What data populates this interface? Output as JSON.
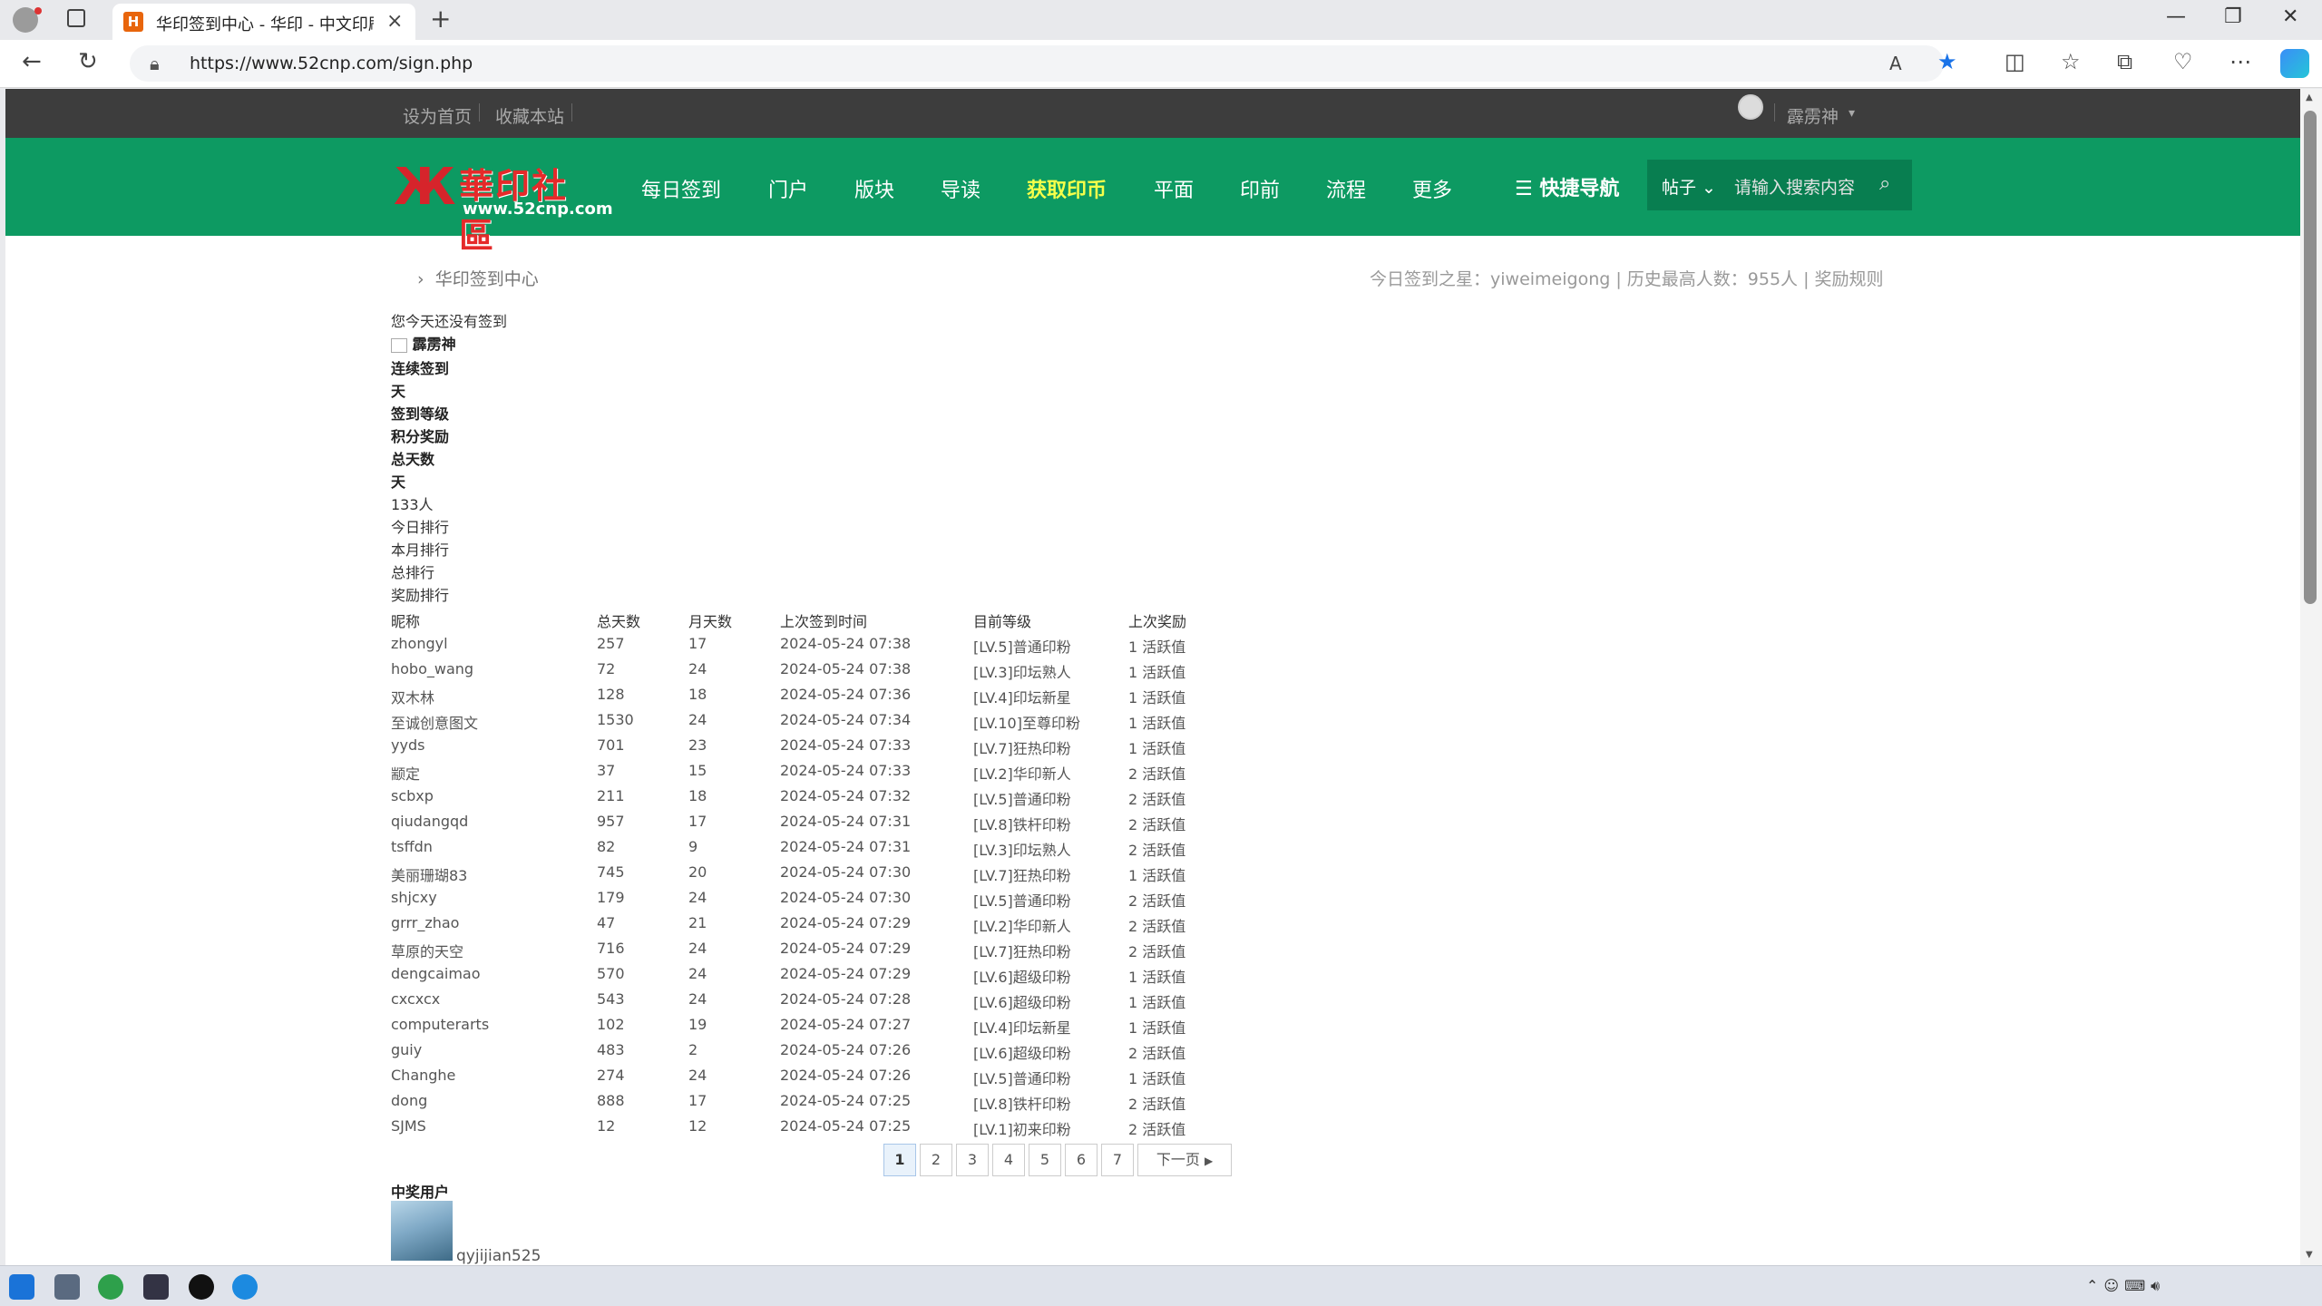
{
  "browser": {
    "tab_title": "华印签到中心 - 华印 - 中文印刷",
    "url": "https://www.52cnp.com/sign.php",
    "favicon_icon": "52cnp-logo-icon"
  },
  "site": {
    "top_links": [
      "设为首页",
      "收藏本站"
    ],
    "username": "霹雳神",
    "logo_cn": "華印社區",
    "logo_en": "www.52cnp.com",
    "nav": [
      "每日签到",
      "门户",
      "版块",
      "导读",
      "获取印币",
      "平面",
      "印前",
      "流程",
      "更多"
    ],
    "nav_highlight": "获取印币",
    "quick_nav": "☰ 快捷导航",
    "search_select": "帖子",
    "search_placeholder": "请输入搜索内容"
  },
  "breadcrumb": "华印签到中心",
  "stats": {
    "text": "今日签到之星：yiweimeigong  |  历史最高人数：955人  |  奖励规则"
  },
  "status": {
    "not_signed": "您今天还没有签到",
    "user_label": "霹雳神",
    "continuous": "连续签到",
    "day1": "天",
    "level": "签到等级",
    "points": "积分奖励",
    "total_days": "总天数",
    "day2": "天",
    "count": "133人",
    "today_rank": "今日排行",
    "month_rank": "本月排行",
    "total_rank": "总排行",
    "reward_rank": "奖励排行"
  },
  "table": {
    "headers": [
      "昵称",
      "总天数",
      "月天数",
      "上次签到时间",
      "目前等级",
      "上次奖励"
    ],
    "rows": [
      [
        "zhongyl",
        "257",
        "17",
        "2024-05-24 07:38",
        "[LV.5]普通印粉",
        "1 活跃值"
      ],
      [
        "hobo_wang",
        "72",
        "24",
        "2024-05-24 07:38",
        "[LV.3]印坛熟人",
        "1 活跃值"
      ],
      [
        "双木林",
        "128",
        "18",
        "2024-05-24 07:36",
        "[LV.4]印坛新星",
        "1 活跃值"
      ],
      [
        "至诚创意图文",
        "1530",
        "24",
        "2024-05-24 07:34",
        "[LV.10]至尊印粉",
        "1 活跃值"
      ],
      [
        "yyds",
        "701",
        "23",
        "2024-05-24 07:33",
        "[LV.7]狂热印粉",
        "1 活跃值"
      ],
      [
        "颛定",
        "37",
        "15",
        "2024-05-24 07:33",
        "[LV.2]华印新人",
        "2 活跃值"
      ],
      [
        "scbxp",
        "211",
        "18",
        "2024-05-24 07:32",
        "[LV.5]普通印粉",
        "2 活跃值"
      ],
      [
        "qiudangqd",
        "957",
        "17",
        "2024-05-24 07:31",
        "[LV.8]铁杆印粉",
        "2 活跃值"
      ],
      [
        "tsffdn",
        "82",
        "9",
        "2024-05-24 07:31",
        "[LV.3]印坛熟人",
        "2 活跃值"
      ],
      [
        "美丽珊瑚83",
        "745",
        "20",
        "2024-05-24 07:30",
        "[LV.7]狂热印粉",
        "1 活跃值"
      ],
      [
        "shjcxy",
        "179",
        "24",
        "2024-05-24 07:30",
        "[LV.5]普通印粉",
        "2 活跃值"
      ],
      [
        "grrr_zhao",
        "47",
        "21",
        "2024-05-24 07:29",
        "[LV.2]华印新人",
        "2 活跃值"
      ],
      [
        "草原的天空",
        "716",
        "24",
        "2024-05-24 07:29",
        "[LV.7]狂热印粉",
        "2 活跃值"
      ],
      [
        "dengcaimao",
        "570",
        "24",
        "2024-05-24 07:29",
        "[LV.6]超级印粉",
        "1 活跃值"
      ],
      [
        "cxcxcx",
        "543",
        "24",
        "2024-05-24 07:28",
        "[LV.6]超级印粉",
        "1 活跃值"
      ],
      [
        "computerarts",
        "102",
        "19",
        "2024-05-24 07:27",
        "[LV.4]印坛新星",
        "1 活跃值"
      ],
      [
        "guiy",
        "483",
        "2",
        "2024-05-24 07:26",
        "[LV.6]超级印粉",
        "2 活跃值"
      ],
      [
        "Changhe",
        "274",
        "24",
        "2024-05-24 07:26",
        "[LV.5]普通印粉",
        "1 活跃值"
      ],
      [
        "dong",
        "888",
        "17",
        "2024-05-24 07:25",
        "[LV.8]铁杆印粉",
        "2 活跃值"
      ],
      [
        "SJMS",
        "12",
        "12",
        "2024-05-24 07:25",
        "[LV.1]初来印粉",
        "2 活跃值"
      ]
    ]
  },
  "pager": {
    "pages": [
      "1",
      "2",
      "3",
      "4",
      "5",
      "6",
      "7"
    ],
    "current": "1",
    "next": "下一页"
  },
  "winners": {
    "title": "中奖用户",
    "name": "qyjijian525"
  },
  "colors": {
    "green": "#0d9a62",
    "topbar": "#3d3d3d",
    "highlight": "#f6ff4a"
  }
}
